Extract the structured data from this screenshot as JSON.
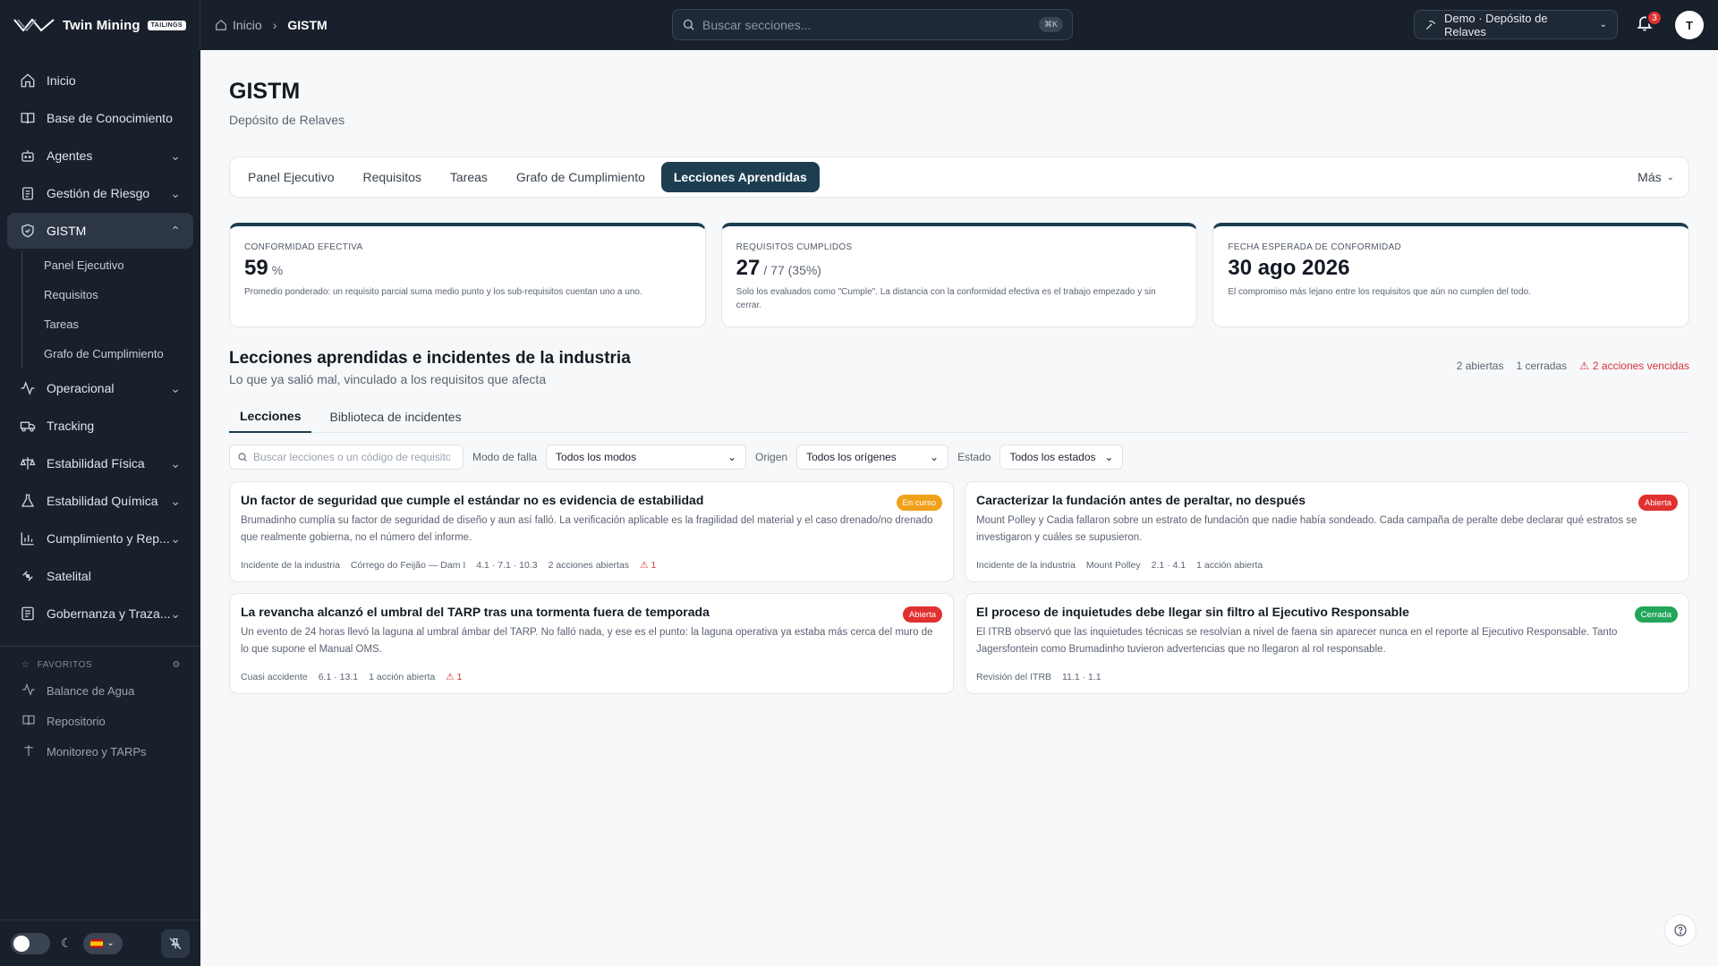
{
  "brand": {
    "name": "Twin Mining",
    "tag": "TAILINGS"
  },
  "breadcrumb": {
    "home": "Inicio",
    "current": "GISTM"
  },
  "search": {
    "placeholder": "Buscar secciones...",
    "shortcut": "⌘K"
  },
  "project": {
    "label": "Demo · Depósito de Relaves"
  },
  "notifications": {
    "count": "3"
  },
  "user": {
    "initial": "T"
  },
  "sidebar": {
    "items": [
      {
        "label": "Inicio",
        "icon": "home-icon"
      },
      {
        "label": "Base de Conocimiento",
        "icon": "book-icon"
      },
      {
        "label": "Agentes",
        "icon": "robot-icon"
      },
      {
        "label": "Gestión de Riesgo",
        "icon": "clipboard-icon"
      },
      {
        "label": "GISTM",
        "icon": "shield-icon"
      },
      {
        "label": "Operacional",
        "icon": "activity-icon"
      },
      {
        "label": "Tracking",
        "icon": "truck-icon"
      },
      {
        "label": "Estabilidad Física",
        "icon": "scale-icon"
      },
      {
        "label": "Estabilidad Química",
        "icon": "flask-icon"
      },
      {
        "label": "Cumplimiento y Rep...",
        "icon": "bar-chart-icon"
      },
      {
        "label": "Satelital",
        "icon": "satellite-icon"
      },
      {
        "label": "Gobernanza y Traza...",
        "icon": "document-icon"
      }
    ],
    "gistm_sub": [
      "Panel Ejecutivo",
      "Requisitos",
      "Tareas",
      "Grafo de Cumplimiento"
    ],
    "favorites_title": "FAVORITOS",
    "favorites": [
      "Balance de Agua",
      "Repositorio",
      "Monitoreo y TARPs"
    ]
  },
  "page": {
    "title": "GISTM",
    "subtitle": "Depósito de Relaves"
  },
  "tabs": [
    "Panel Ejecutivo",
    "Requisitos",
    "Tareas",
    "Grafo de Cumplimiento",
    "Lecciones Aprendidas"
  ],
  "tabs_more": "Más",
  "kpis": [
    {
      "label": "CONFORMIDAD EFECTIVA",
      "value": "59",
      "suffix": "%",
      "note": "Promedio ponderado: un requisito parcial suma medio punto y los sub-requisitos cuentan uno a uno."
    },
    {
      "label": "REQUISITOS CUMPLIDOS",
      "value": "27",
      "suffix": "/ 77  (35%)",
      "note": "Solo los evaluados como \"Cumple\". La distancia con la conformidad efectiva es el trabajo empezado y sin cerrar."
    },
    {
      "label": "FECHA ESPERADA DE CONFORMIDAD",
      "value": "30 ago 2026",
      "suffix": "",
      "note": "El compromiso más lejano entre los requisitos que aún no cumplen del todo."
    }
  ],
  "lessons": {
    "title": "Lecciones aprendidas e incidentes de la industria",
    "subtitle": "Lo que ya salió mal, vinculado a los requisitos que afecta",
    "open": "2 abiertas",
    "closed": "1 cerradas",
    "overdue": "2 acciones vencidas",
    "subtabs": [
      "Lecciones",
      "Biblioteca de incidentes"
    ],
    "filters": {
      "search_placeholder": "Buscar lecciones o un código de requisito",
      "mode_label": "Modo de falla",
      "mode_value": "Todos los modos",
      "origin_label": "Origen",
      "origin_value": "Todos los orígenes",
      "state_label": "Estado",
      "state_value": "Todos los estados"
    },
    "cards": [
      {
        "title": "Un factor de seguridad que cumple el estándar no es evidencia de estabilidad",
        "status": "En curso",
        "description": "Brumadinho cumplía su factor de seguridad de diseño y aun así falló. La verificación aplicable es la fragilidad del material y el caso drenado/no drenado que realmente gobierna, no el número del informe.",
        "meta": [
          "Incidente de la industria",
          "Córrego do Feijão — Dam I",
          "4.1 · 7.1 · 10.3",
          "2 acciones abiertas"
        ],
        "alerts": "1"
      },
      {
        "title": "Caracterizar la fundación antes de peraltar, no después",
        "status": "Abierta",
        "description": "Mount Polley y Cadia fallaron sobre un estrato de fundación que nadie había sondeado. Cada campaña de peralte debe declarar qué estratos se investigaron y cuáles se supusieron.",
        "meta": [
          "Incidente de la industria",
          "Mount Polley",
          "2.1 · 4.1",
          "1 acción abierta"
        ],
        "alerts": ""
      },
      {
        "title": "La revancha alcanzó el umbral del TARP tras una tormenta fuera de temporada",
        "status": "Abierta",
        "description": "Un evento de 24 horas llevó la laguna al umbral ámbar del TARP. No falló nada, y ese es el punto: la laguna operativa ya estaba más cerca del muro de lo que supone el Manual OMS.",
        "meta": [
          "Cuasi accidente",
          "6.1 · 13.1",
          "1 acción abierta"
        ],
        "alerts": "1"
      },
      {
        "title": "El proceso de inquietudes debe llegar sin filtro al Ejecutivo Responsable",
        "status": "Cerrada",
        "description": "El ITRB observó que las inquietudes técnicas se resolvían a nivel de faena sin aparecer nunca en el reporte al Ejecutivo Responsable. Tanto Jagersfontein como Brumadinho tuvieron advertencias que no llegaron al rol responsable.",
        "meta": [
          "Revisión del ITRB",
          "11.1 · 1.1"
        ],
        "alerts": ""
      }
    ]
  }
}
